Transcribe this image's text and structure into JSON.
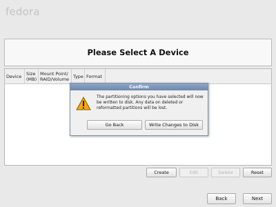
{
  "brand": {
    "logo_text": "fedora"
  },
  "header": {
    "title": "Please Select A Device"
  },
  "table": {
    "columns": [
      {
        "label": "Device"
      },
      {
        "label": "Size\n(MB)"
      },
      {
        "label": "Mount Point/\nRAID/Volume"
      },
      {
        "label": "Type"
      },
      {
        "label": "Format"
      }
    ],
    "rows": []
  },
  "partition_buttons": {
    "create": "Create",
    "edit": "Edit",
    "delete": "Delete",
    "reset": "Reset"
  },
  "nav": {
    "back": "Back",
    "next": "Next"
  },
  "dialog": {
    "title": "Confirm",
    "icon": "warning-icon",
    "message": "The partitioning options you have selected will now be written to disk.  Any data on deleted or reformatted partitions will be lost.",
    "go_back_label": "Go Back",
    "write_label": "Write Changes to Disk"
  },
  "colors": {
    "background": "#e9e9e9",
    "dialog_titlebar": "#7d93b6",
    "warning_fill": "#f2a90f"
  }
}
